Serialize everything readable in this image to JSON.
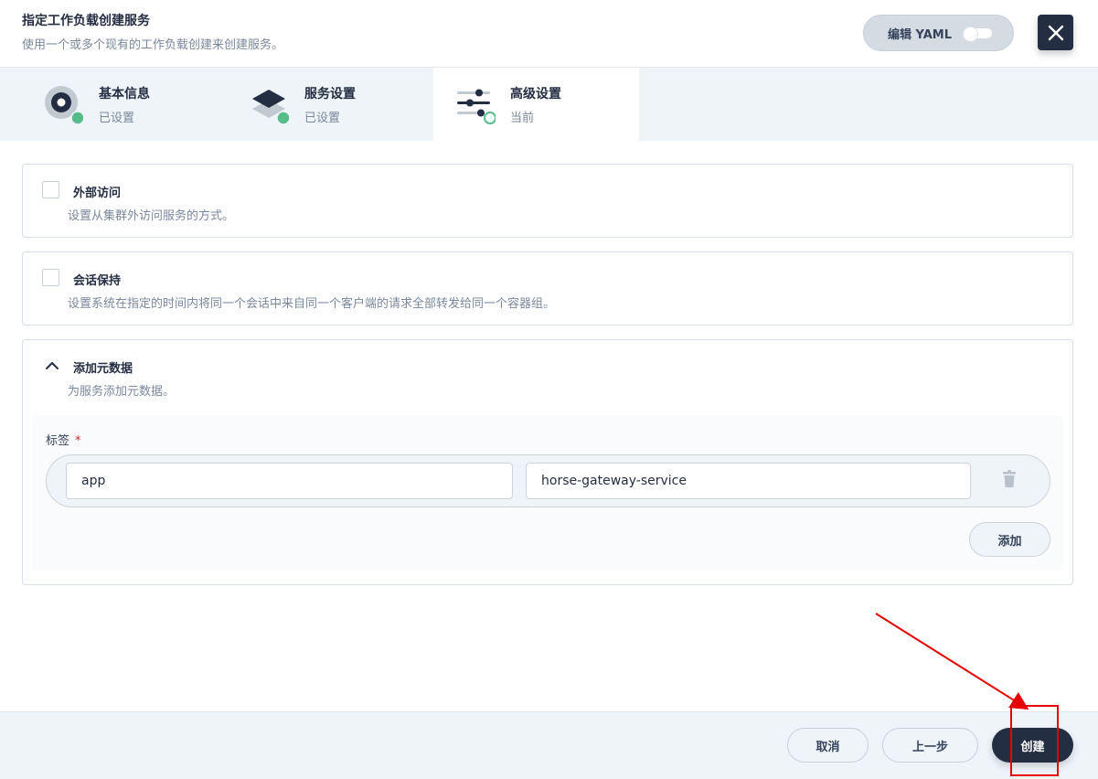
{
  "header": {
    "title": "指定工作负载创建服务",
    "subtitle": "使用一个或多个现有的工作负载创建来创建服务。",
    "yaml_toggle_label": "编辑 YAML"
  },
  "steps": [
    {
      "title": "基本信息",
      "status": "已设置"
    },
    {
      "title": "服务设置",
      "status": "已设置"
    },
    {
      "title": "高级设置",
      "status": "当前"
    }
  ],
  "sections": {
    "external_access": {
      "title": "外部访问",
      "description": "设置从集群外访问服务的方式。",
      "checked": false
    },
    "session_affinity": {
      "title": "会话保持",
      "description": "设置系统在指定的时间内将同一个会话中来自同一个客户端的请求全部转发给同一个容器组。",
      "checked": false
    },
    "metadata": {
      "title": "添加元数据",
      "description": "为服务添加元数据。",
      "labels_title": "标签",
      "required_mark": "*",
      "labels": [
        {
          "key": "app",
          "value": "horse-gateway-service"
        }
      ],
      "add_label": "添加"
    }
  },
  "footer": {
    "cancel_label": "取消",
    "previous_label": "上一步",
    "create_label": "创建"
  },
  "colors": {
    "primary_dark": "#242e42",
    "success_green": "#55bc8a",
    "annotation_red": "#e60000"
  }
}
